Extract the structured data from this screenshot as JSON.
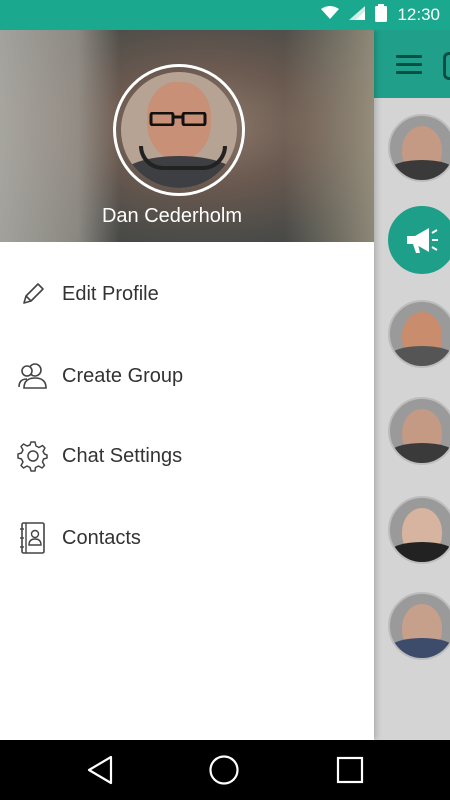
{
  "status_bar": {
    "time": "12:30",
    "icons": [
      "wifi-icon",
      "signal-icon",
      "battery-icon"
    ]
  },
  "drawer": {
    "user": {
      "name": "Dan Cederholm"
    },
    "menu": [
      {
        "label": "Edit Profile",
        "icon": "pencil-icon"
      },
      {
        "label": "Create Group",
        "icon": "group-icon"
      },
      {
        "label": "Chat Settings",
        "icon": "gear-icon"
      },
      {
        "label": "Contacts",
        "icon": "contacts-book-icon"
      }
    ]
  },
  "background_app": {
    "accent_color": "#1aa88f",
    "list_avatars": [
      "contact-avatar",
      "broadcast-megaphone",
      "contact-avatar",
      "contact-avatar",
      "contact-avatar",
      "contact-avatar"
    ]
  },
  "nav_bar": {
    "buttons": [
      "back-icon",
      "home-icon",
      "recents-icon"
    ]
  },
  "colors": {
    "status_bar": "#1aa88f",
    "app_bar": "#20a08b",
    "text": "#333333"
  }
}
